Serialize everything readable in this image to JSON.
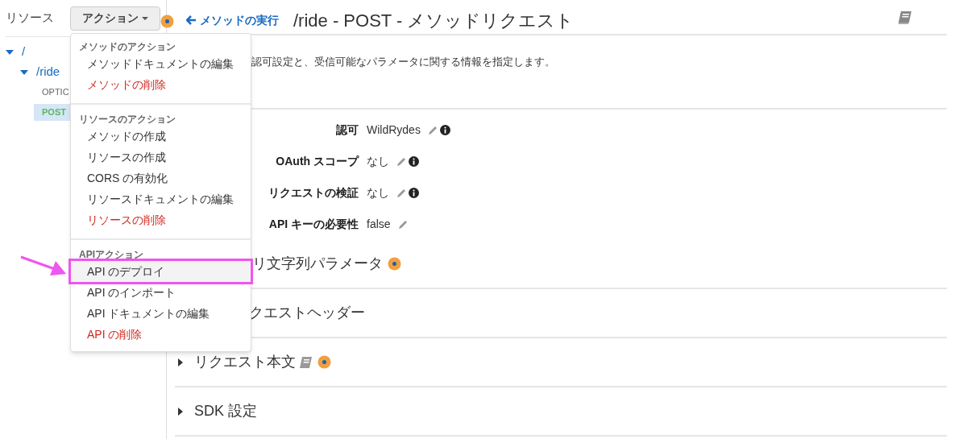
{
  "sidebar": {
    "title": "リソース",
    "actions_button": "アクション",
    "tree": [
      {
        "label": "/",
        "expanded": true,
        "children": [
          {
            "label": "/ride",
            "expanded": true,
            "children": [
              {
                "label": "OPTIC",
                "kind": "method",
                "selected": false
              },
              {
                "label": "POST",
                "kind": "method",
                "selected": true
              }
            ]
          }
        ]
      }
    ]
  },
  "header": {
    "back_link": "メソッドの実行",
    "title": "/ride - POST - メソッドリクエスト"
  },
  "description": "認可設定と、受信可能なパラメータに関する情報を指定します。",
  "settings": [
    {
      "label": "認可",
      "value": "WildRydes",
      "info": true
    },
    {
      "label": "OAuth スコープ",
      "value": "なし",
      "info": true
    },
    {
      "label": "リクエストの検証",
      "value": "なし",
      "info": true
    },
    {
      "label": "API キーの必要性",
      "value": "false",
      "info": false
    }
  ],
  "sections": [
    {
      "title": "リ文字列パラメータ",
      "caret": false,
      "doc": false,
      "badge": true
    },
    {
      "title": "クエストヘッダー",
      "caret": false,
      "doc": false,
      "badge": false
    },
    {
      "title": "リクエスト本文",
      "caret": true,
      "doc": true,
      "badge": true
    },
    {
      "title": "SDK 設定",
      "caret": true,
      "doc": false,
      "badge": false
    }
  ],
  "action_menu": {
    "groups": [
      {
        "heading": "メソッドのアクション",
        "items": [
          {
            "label": "メソッドドキュメントの編集",
            "destructive": false,
            "selected": false
          },
          {
            "label": "メソッドの削除",
            "destructive": true,
            "selected": false
          }
        ]
      },
      {
        "heading": "リソースのアクション",
        "items": [
          {
            "label": "メソッドの作成",
            "destructive": false,
            "selected": false
          },
          {
            "label": "リソースの作成",
            "destructive": false,
            "selected": false
          },
          {
            "label": "CORS の有効化",
            "destructive": false,
            "selected": false
          },
          {
            "label": "リソースドキュメントの編集",
            "destructive": false,
            "selected": false
          },
          {
            "label": "リソースの削除",
            "destructive": true,
            "selected": false
          }
        ]
      },
      {
        "heading": "APIアクション",
        "items": [
          {
            "label": "API のデプロイ",
            "destructive": false,
            "selected": true
          },
          {
            "label": "API のインポート",
            "destructive": false,
            "selected": false
          },
          {
            "label": "API ドキュメントの編集",
            "destructive": false,
            "selected": false
          },
          {
            "label": "API の削除",
            "destructive": true,
            "selected": false
          }
        ]
      }
    ]
  }
}
